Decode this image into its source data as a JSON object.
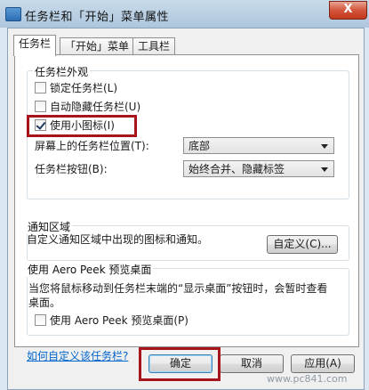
{
  "window": {
    "title": "任务栏和「开始」菜单属性",
    "close": "X"
  },
  "tabs": [
    {
      "label": "任务栏"
    },
    {
      "label": "「开始」菜单"
    },
    {
      "label": "工具栏"
    }
  ],
  "appearance": {
    "title": "任务栏外观",
    "lock": {
      "label": "锁定任务栏(L)",
      "checked": false
    },
    "autohide": {
      "label": "自动隐藏任务栏(U)",
      "checked": false
    },
    "small_icons": {
      "label": "使用小图标(I)",
      "checked": true
    },
    "position_label": "屏幕上的任务栏位置(T):",
    "position_value": "底部",
    "buttons_label": "任务栏按钮(B):",
    "buttons_value": "始终合并、隐藏标签"
  },
  "notify": {
    "title": "通知区域",
    "text": "自定义通知区域中出现的图标和通知。",
    "customize": "自定义(C)..."
  },
  "peek": {
    "title": "使用 Aero Peek 预览桌面",
    "description": "当您将鼠标移动到任务栏末端的“显示桌面”按钮时，会暂时查看桌面。",
    "checkbox": {
      "label": "使用 Aero Peek 预览桌面(P)",
      "checked": false
    }
  },
  "help_link": "如何自定义该任务栏?",
  "footer": {
    "ok": "确定",
    "cancel": "取消",
    "apply": "应用(A)"
  },
  "watermark": "www.pc841.com"
}
